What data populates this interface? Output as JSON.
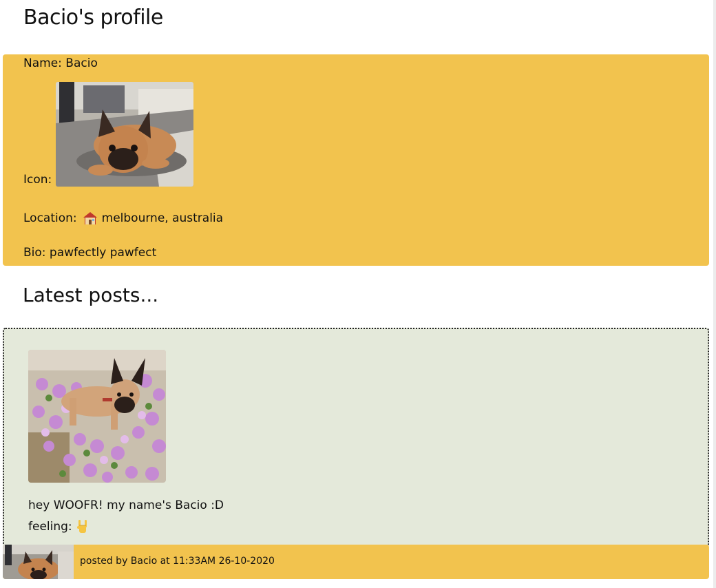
{
  "profile": {
    "title": "Bacio's profile",
    "name_label": "Name:",
    "name_value": "Bacio",
    "icon_label": "Icon:",
    "location_label": "Location:",
    "location_value": "melbourne, australia",
    "bio_label": "Bio:",
    "bio_value": "pawfectly pawfect"
  },
  "posts": {
    "section_title": "Latest posts...",
    "items": [
      {
        "text": "hey WOOFR! my name's Bacio :D",
        "feeling_label": "feeling:",
        "feeling_icon": "rock-on-hand-icon",
        "footer": "posted by Bacio at 11:33AM 26-10-2020"
      }
    ]
  },
  "colors": {
    "profile_bg": "#f2c34e",
    "post_bg": "#e4e9da",
    "footer_bg": "#f2c34e"
  }
}
